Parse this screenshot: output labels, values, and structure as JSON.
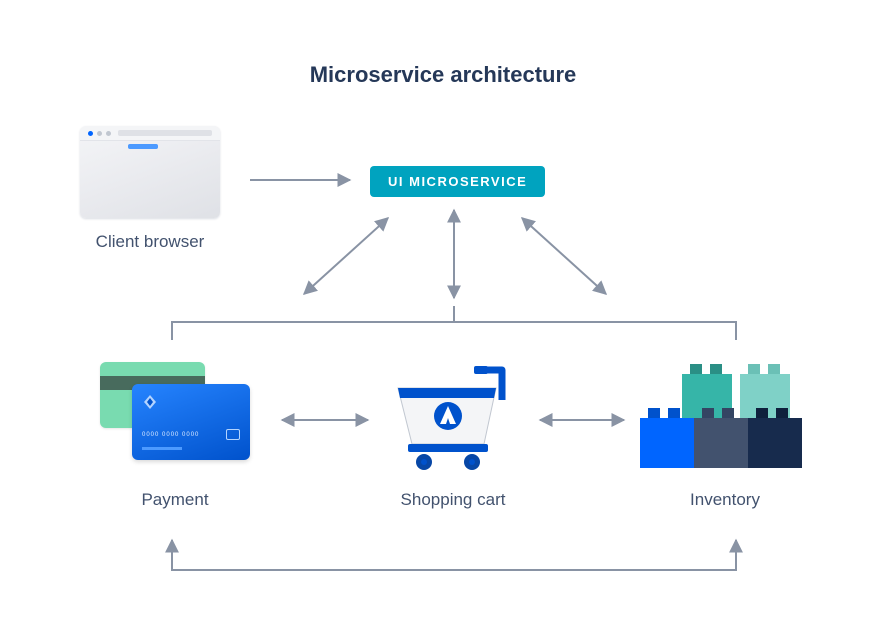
{
  "title": "Microservice architecture",
  "nodes": {
    "client_browser": {
      "label": "Client browser"
    },
    "ui_microservice": {
      "label": "UI MICROSERVICE"
    },
    "payment": {
      "label": "Payment"
    },
    "shopping_cart": {
      "label": "Shopping cart"
    },
    "inventory": {
      "label": "Inventory"
    }
  },
  "edges": [
    {
      "from": "client_browser",
      "to": "ui_microservice",
      "bidirectional": false
    },
    {
      "from": "ui_microservice",
      "to": "payment",
      "bidirectional": true
    },
    {
      "from": "ui_microservice",
      "to": "shopping_cart",
      "bidirectional": true
    },
    {
      "from": "ui_microservice",
      "to": "inventory",
      "bidirectional": true
    },
    {
      "from": "payment",
      "to": "shopping_cart",
      "bidirectional": true
    },
    {
      "from": "shopping_cart",
      "to": "inventory",
      "bidirectional": true
    },
    {
      "from": "payment",
      "to": "inventory",
      "bidirectional": true,
      "routed_below": true
    }
  ],
  "colors": {
    "title": "#253858",
    "label": "#42526e",
    "arrow": "#8993a4",
    "pill_bg": "#00a3bf",
    "pill_fg": "#ffffff",
    "card_back": "#79dbb0",
    "card_front_from": "#2684ff",
    "card_front_to": "#0052cc",
    "cart_primary": "#0052cc",
    "cart_basket": "#f4f5f7",
    "block_teal": "#36b5a8",
    "block_light_teal": "#7fd1c7",
    "block_blue": "#0065ff",
    "block_navy": "#42526e",
    "block_dark": "#172b4d"
  }
}
